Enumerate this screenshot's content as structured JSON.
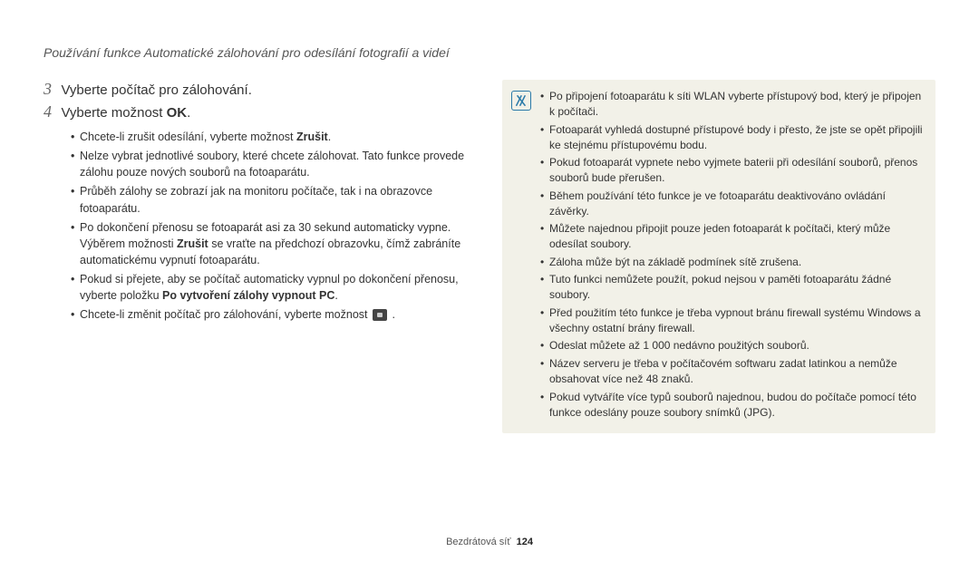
{
  "header": "Používání funkce Automatické zálohování pro odesílání fotografií a videí",
  "steps": [
    {
      "num": "3",
      "text": "Vyberte počítač pro zálohování."
    },
    {
      "num": "4",
      "text_pre": "Vyberte možnost ",
      "bold": "OK",
      "text_post": "."
    }
  ],
  "sub": [
    {
      "pre": "Chcete-li zrušit odesílání, vyberte možnost ",
      "b": "Zrušit",
      "post": "."
    },
    {
      "text": "Nelze vybrat jednotlivé soubory, které chcete zálohovat. Tato funkce provede zálohu pouze nových souborů na fotoaparátu."
    },
    {
      "text": "Průběh zálohy se zobrazí jak na monitoru počítače, tak i na obrazovce fotoaparátu."
    },
    {
      "pre": "Po dokončení přenosu se fotoaparát asi za 30 sekund automaticky vypne. Výběrem možnosti ",
      "b": "Zrušit",
      "post": " se vraťte na předchozí obrazovku, čímž zabráníte automatickému vypnutí fotoaparátu."
    },
    {
      "pre": "Pokud si přejete, aby se počítač automaticky vypnul po dokončení přenosu, vyberte položku ",
      "b": "Po vytvoření zálohy vypnout PC",
      "post": "."
    },
    {
      "text": "Chcete-li změnit počítač pro zálohování, vyberte možnost ",
      "icon": true,
      "post2": " ."
    }
  ],
  "notes": [
    "Po připojení fotoaparátu k síti WLAN vyberte přístupový bod, který je připojen k počítači.",
    "Fotoaparát vyhledá dostupné přístupové body i přesto, že jste se opět připojili ke stejnému přístupovému bodu.",
    "Pokud fotoaparát vypnete nebo vyjmete baterii při odesílání souborů, přenos souborů bude přerušen.",
    "Během používání této funkce je ve fotoaparátu deaktivováno ovládání závěrky.",
    "Můžete najednou připojit pouze jeden fotoaparát k počítači, který může odesílat soubory.",
    "Záloha může být na základě podmínek sítě zrušena.",
    "Tuto funkci nemůžete použít, pokud nejsou v paměti fotoaparátu žádné soubory.",
    "Před použitím této funkce je třeba vypnout bránu firewall systému Windows a všechny ostatní brány firewall.",
    "Odeslat můžete až 1 000 nedávno použitých souborů.",
    "Název serveru je třeba v počítačovém softwaru zadat latinkou a nemůže obsahovat více než 48 znaků.",
    "Pokud vytváříte více typů souborů najednou, budou do počítače pomocí této funkce odeslány pouze soubory snímků (JPG)."
  ],
  "footer": {
    "label": "Bezdrátová síť",
    "page": "124"
  }
}
